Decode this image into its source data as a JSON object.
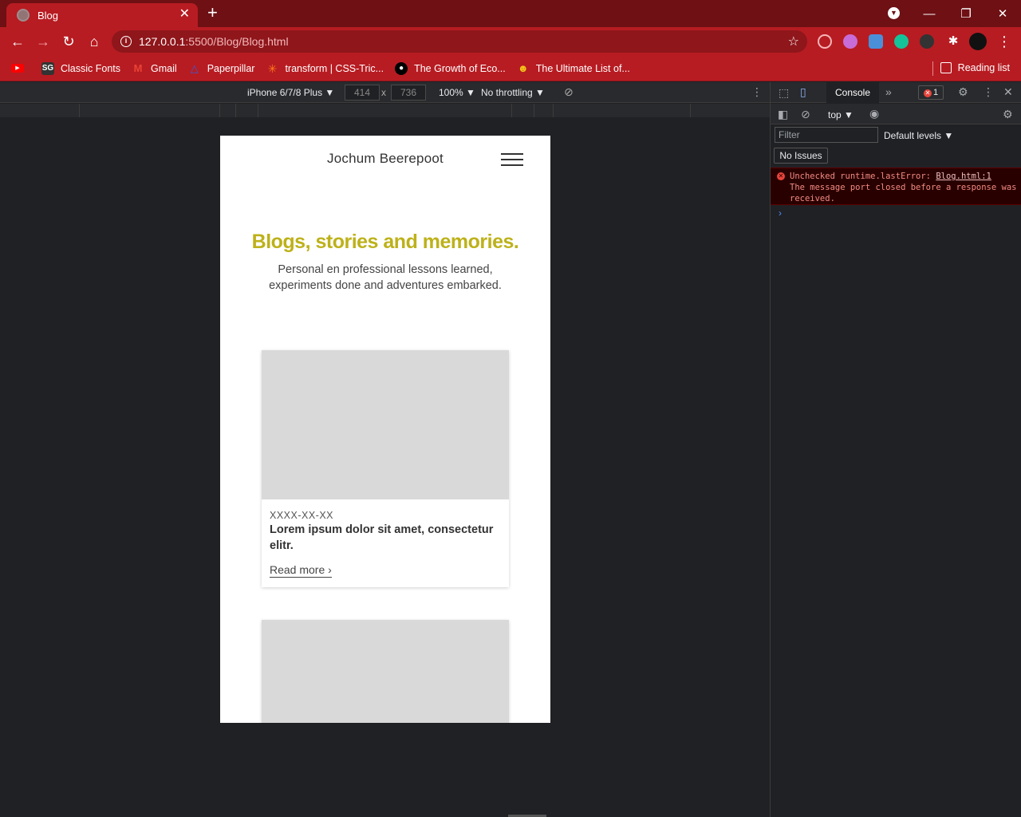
{
  "browser": {
    "tab_title": "Blog",
    "tab_close": "✕",
    "new_tab": "+",
    "url_host": "127.0.0.1",
    "url_path": ":5500/Blog/Blog.html",
    "window_controls": [
      "—",
      "❐",
      "✕"
    ]
  },
  "bookmarks": [
    {
      "label": "Classic Fonts",
      "icon": "sg-icon",
      "color": "#333333"
    },
    {
      "label": "Gmail",
      "icon": "gmail-icon",
      "color": "#ea4335"
    },
    {
      "label": "Paperpillar",
      "icon": "paperpillar-icon",
      "color": "#3b5bdb"
    },
    {
      "label": "transform | CSS-Tric...",
      "icon": "css-tricks-icon",
      "color": "#ff7a18"
    },
    {
      "label": "The Growth of Eco...",
      "icon": "medium-icon",
      "color": "#000000"
    },
    {
      "label": "The Ultimate List of...",
      "icon": "list-icon",
      "color": "#f5c518"
    }
  ],
  "reading_list": "Reading list",
  "device_toolbar": {
    "device": "iPhone 6/7/8 Plus ▼",
    "width": "414",
    "height": "736",
    "times": "x",
    "zoom": "100% ▼",
    "throttle": "No throttling ▼"
  },
  "site": {
    "name": "Jochum Beerepoot",
    "hero_title": "Blogs, stories and memories.",
    "hero_sub": "Personal en professional lessons learned, experiments done and adventures embarked.",
    "cards": [
      {
        "date": "XXXX-XX-XX",
        "title": "Lorem ipsum dolor sit amet, consectetur elitr.",
        "more": "Read more ›"
      }
    ]
  },
  "devtools": {
    "console_tab": "Console",
    "more_tabs": "»",
    "error_count": "1",
    "context": "top ▼",
    "filter_placeholder": "Filter",
    "levels": "Default levels ▼",
    "issues": "No Issues",
    "error_text": "Unchecked runtime.lastError:",
    "error_link": "Blog.html:1",
    "error_message": "The message port closed before a response was received.",
    "prompt": "›"
  },
  "colors": {
    "accent_title": "#bdb11a",
    "chrome_red": "#b71c22",
    "chrome_dark": "#6e1014"
  }
}
